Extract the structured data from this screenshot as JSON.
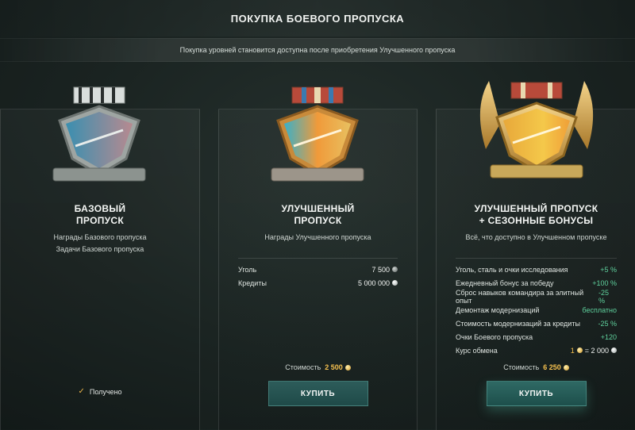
{
  "header": {
    "title": "ПОКУПКА БОЕВОГО ПРОПУСКА",
    "notice": "Покупка уровней становится доступна после приобретения Улучшенного пропуска"
  },
  "cards": {
    "base": {
      "title_line1": "БАЗОВЫЙ",
      "title_line2": "ПРОПУСК",
      "desc_line1": "Награды Базового пропуска",
      "desc_line2": "Задачи Базового пропуска",
      "status": "Получено",
      "medal_icon": "base-pass-medal-icon"
    },
    "improved": {
      "title_line1": "УЛУЧШЕННЫЙ",
      "title_line2": "ПРОПУСК",
      "desc_line1": "Награды Улучшенного пропуска",
      "stats": [
        {
          "label": "Уголь",
          "value": "7 500",
          "icon": "coal-icon"
        },
        {
          "label": "Кредиты",
          "value": "5 000 000",
          "icon": "credits-icon"
        }
      ],
      "cost_label": "Стоимость",
      "cost_value": "2 500",
      "cost_icon": "gold-icon",
      "buy_label": "КУПИТЬ",
      "medal_icon": "improved-pass-medal-icon"
    },
    "season": {
      "title_line1": "УЛУЧШЕННЫЙ ПРОПУСК",
      "title_line2": "+ СЕЗОННЫЕ БОНУСЫ",
      "desc_line1": "Всё, что доступно в Улучшенном пропуске",
      "stats": [
        {
          "label": "Уголь, сталь и очки исследования",
          "value": "+5 %"
        },
        {
          "label": "Ежедневный бонус за победу",
          "value": "+100 %"
        },
        {
          "label": "Сброс навыков командира за элитный опыт",
          "value": "-25 %"
        },
        {
          "label": "Демонтаж модернизаций",
          "value": "бесплатно"
        },
        {
          "label": "Стоимость модернизаций за кредиты",
          "value": "-25 %"
        },
        {
          "label": "Очки Боевого пропуска",
          "value": "+120"
        },
        {
          "label": "Курс обмена",
          "value_left": "1",
          "value_right": "= 2 000"
        }
      ],
      "cost_label": "Стоимость",
      "cost_value": "6 250",
      "cost_icon": "gold-icon",
      "buy_label": "КУПИТЬ",
      "medal_icon": "season-pass-medal-icon"
    }
  },
  "colors": {
    "accent_gold": "#f6c14f",
    "bonus_green": "#5fd19d",
    "button_teal": "#2d5c5a",
    "check_gold": "#e9b44c"
  }
}
